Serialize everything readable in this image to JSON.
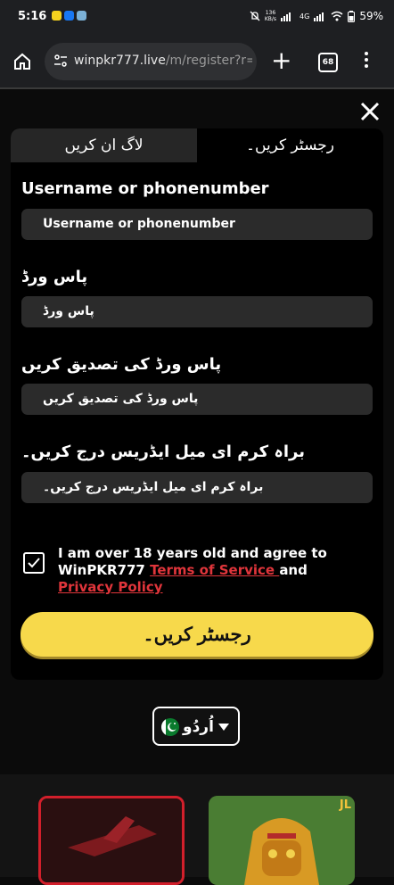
{
  "status_bar": {
    "time": "5:16",
    "network_top": "136",
    "network_bottom": "KB/s",
    "signal": "4G",
    "battery": "59%"
  },
  "browser": {
    "url_host": "winpkr777.live",
    "url_path": "/m/register?r=ptk",
    "tab_count": "68"
  },
  "tabs": {
    "login": "لاگ ان کریں",
    "register": "رجسٹر کریں۔"
  },
  "form": {
    "username_label": "Username or phonenumber",
    "username_placeholder": "Username or phonenumber",
    "password_label": "پاس ورڈ",
    "password_placeholder": "پاس ورڈ",
    "confirm_label": "پاس ورڈ کی تصدیق کریں",
    "confirm_placeholder": "پاس ورڈ کی تصدیق کریں",
    "email_label": "براہ کرم ای میل ایڈریس درج کریں۔",
    "email_placeholder": "براہ کرم ای میل ایڈریس درج کریں۔"
  },
  "terms": {
    "prefix": "I am over 18 years old and agree to WinPKR777 ",
    "terms_link": "Terms of Service ",
    "and": "and ",
    "privacy_link": "Privacy Policy"
  },
  "register_button": "رجسٹر کریں۔",
  "language": {
    "selected": "اُردُو"
  },
  "game_card": {
    "badge": "JL"
  },
  "colors": {
    "accent_yellow": "#f7d94b",
    "link_red": "#e0353b",
    "field_bg": "#2b2b2b",
    "tab_inactive": "#262626"
  }
}
